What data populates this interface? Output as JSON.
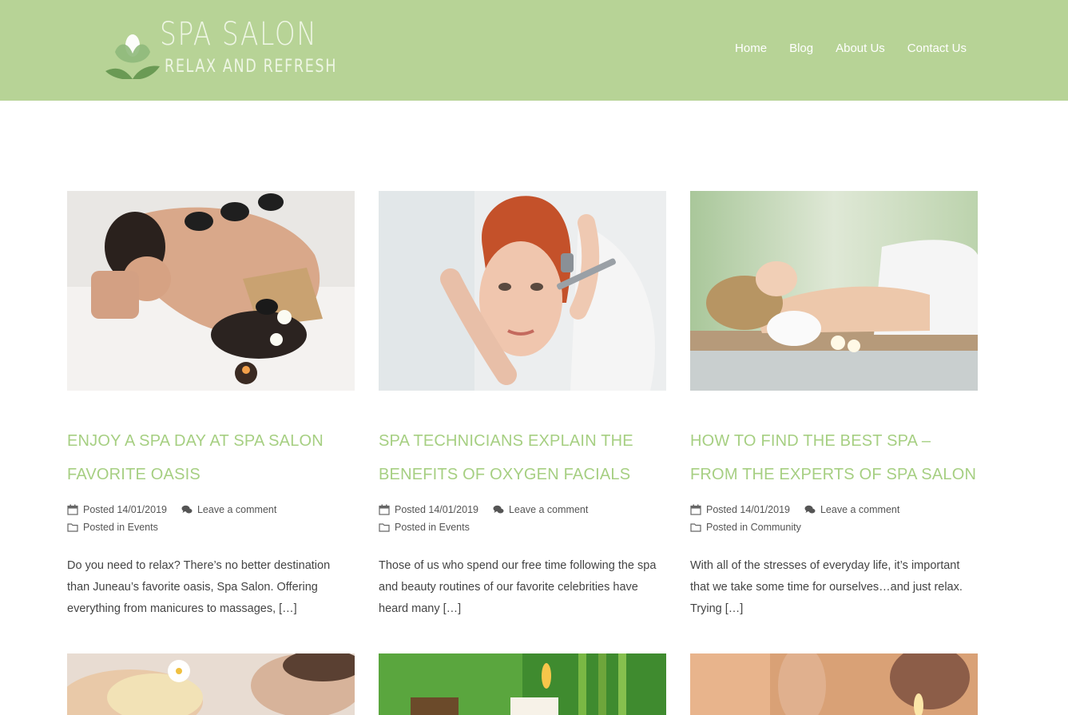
{
  "site": {
    "title": "SPA SALON",
    "tagline": "RELAX AND REFRESH",
    "colors": {
      "header_bg": "#b7d396",
      "title_green": "#a6cf82"
    }
  },
  "nav": {
    "items": [
      {
        "label": "Home"
      },
      {
        "label": "Blog"
      },
      {
        "label": "About Us"
      },
      {
        "label": "Contact Us"
      }
    ]
  },
  "posts": [
    {
      "title": "Enjoy a spa day at Spa Salon favorite oasis",
      "posted_label": "Posted",
      "date": "14/01/2019",
      "comment_label": "Leave a comment",
      "category_label": "Posted in",
      "category": "Events",
      "excerpt": "Do you need to relax? There’s no better destination than Juneau’s favorite oasis, Spa Salon. Offering everything from manicures to massages, […]"
    },
    {
      "title": "Spa Technicians Explain the Benefits of Oxygen Facials",
      "posted_label": "Posted",
      "date": "14/01/2019",
      "comment_label": "Leave a comment",
      "category_label": "Posted in",
      "category": "Events",
      "excerpt": "Those of us who spend our free time following the spa and beauty routines of our favorite celebrities have heard many […]"
    },
    {
      "title": "How to Find the Best Spa – From the Experts of Spa Salon",
      "posted_label": "Posted",
      "date": "14/01/2019",
      "comment_label": "Leave a comment",
      "category_label": "Posted in",
      "category": "Community",
      "excerpt": "With all of the stresses of everyday life, it’s important that we take some time for ourselves…and just relax. Trying […]"
    }
  ],
  "icons": {
    "logo": "lotus-logo-icon",
    "date": "calendar-icon",
    "comment": "comment-bubbles-icon",
    "category": "folder-icon"
  }
}
